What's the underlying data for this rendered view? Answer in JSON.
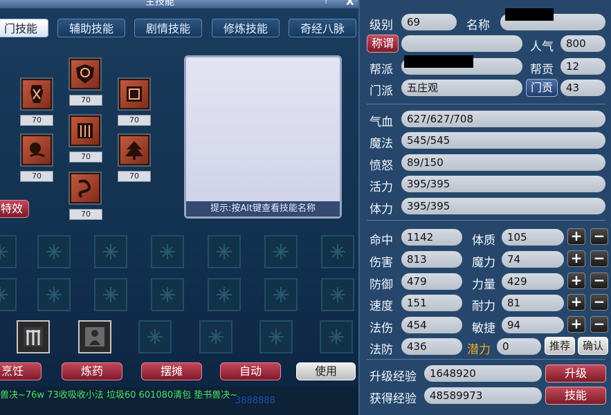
{
  "skills_window": {
    "title": "主技能",
    "help": "?",
    "close": "X",
    "tabs": [
      "师门技能",
      "辅助技能",
      "剧情技能",
      "修炼技能",
      "奇经八脉"
    ],
    "visible_tab_0": "门技能",
    "skills": [
      {
        "level": "70",
        "icon": "shield-swirl-icon"
      },
      {
        "level": "70",
        "icon": "warrior-icon"
      },
      {
        "level": "70",
        "icon": "gate-icon"
      },
      {
        "level": "70",
        "icon": "scroll-icon"
      },
      {
        "level": "70",
        "icon": "ring-icon"
      },
      {
        "level": "70",
        "icon": "tree-icon"
      },
      {
        "level": "70",
        "icon": "chain-icon"
      }
    ],
    "effect_button": "特效",
    "hint": "提示:按Alt键查看技能名称",
    "buttons": {
      "cooking": "烹饪",
      "alchemy": "炼药",
      "stall": "摆摊",
      "auto": "自动",
      "use": "使用"
    },
    "chat_line1": "兽决~76w  73收吸收小法 垃圾60  601080清包  垫书兽决~",
    "chat_line2": "3888888"
  },
  "attributes": {
    "level_label": "级别",
    "level": "69",
    "name_label": "名称",
    "name": "",
    "title_button": "称谓",
    "title_value": "",
    "popularity_label": "人气",
    "popularity": "800",
    "faction_label": "帮派",
    "faction": "",
    "contribution_label": "帮贡",
    "contribution": "12",
    "sect_label": "门派",
    "sect": "五庄观",
    "sect_contribution_button": "门贡",
    "sect_contribution": "43",
    "hp_label": "气血",
    "hp": "627/627/708",
    "mp_label": "魔法",
    "mp": "545/545",
    "rage_label": "愤怒",
    "rage": "89/150",
    "vitality_label": "活力",
    "vitality": "395/395",
    "stamina_label": "体力",
    "stamina": "395/395",
    "hit_label": "命中",
    "hit": "1142",
    "physique_label": "体质",
    "physique": "105",
    "damage_label": "伤害",
    "damage": "813",
    "magic_label": "魔力",
    "magic": "74",
    "defense_label": "防御",
    "defense": "479",
    "strength_label": "力量",
    "strength": "429",
    "speed_label": "速度",
    "speed": "151",
    "endurance_label": "耐力",
    "endurance": "81",
    "spell_damage_label": "法伤",
    "spell_damage": "454",
    "agility_label": "敏捷",
    "agility": "94",
    "spell_defense_label": "法防",
    "spell_defense": "436",
    "potential_label": "潜力",
    "potential": "0",
    "recommend_button": "推荐",
    "confirm_button": "确认",
    "upgrade_exp_label": "升级经验",
    "upgrade_exp": "1648920",
    "gained_exp_label": "获得经验",
    "gained_exp": "48589973",
    "upgrade_button": "升级",
    "skills_button": "技能",
    "plus": "+",
    "minus": "−"
  },
  "colors": {
    "potential": "#f5a623",
    "accent_red": "#9b2a3a",
    "panel_blue": "#26476b"
  }
}
